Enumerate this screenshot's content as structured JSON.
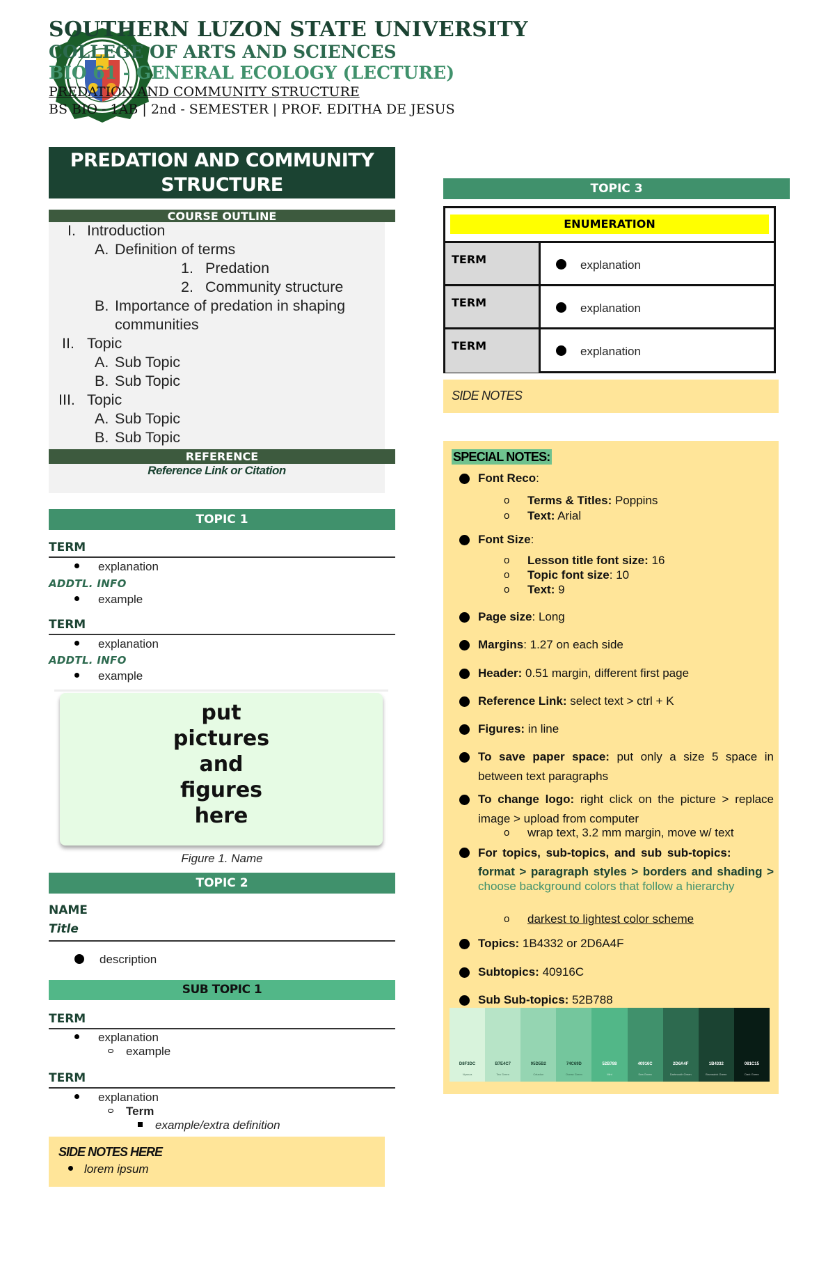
{
  "header": {
    "university": "SOUTHERN LUZON STATE UNIVERSITY",
    "college": "COLLEGE OF ARTS AND SCIENCES",
    "course": "BIO 61 - GENERAL ECOLOGY  (LECTURE)",
    "lesson": "PREDATION AND COMMUNITY STRUCTURE",
    "meta": "BS BIO - 1AB | 2nd - SEMESTER | PROF. EDITHA DE JESUS",
    "logo": "university-seal"
  },
  "lesson_title": "PREDATION AND COMMUNITY STRUCTURE",
  "outline": {
    "label": "COURSE OUTLINE",
    "items": [
      {
        "num": "I.",
        "text": "Introduction"
      },
      {
        "num": "A.",
        "text": "Definition of terms"
      },
      {
        "num": "1.",
        "text": "Predation"
      },
      {
        "num": "2.",
        "text": "Community structure"
      },
      {
        "num": "B.",
        "text": "Importance of predation in shaping"
      },
      {
        "num": "",
        "text": "communities"
      },
      {
        "num": "II.",
        "text": "Topic"
      },
      {
        "num": "A.",
        "text": "Sub Topic"
      },
      {
        "num": "B.",
        "text": "Sub Topic"
      },
      {
        "num": "III.",
        "text": "Topic"
      },
      {
        "num": "A.",
        "text": "Sub Topic"
      },
      {
        "num": "B.",
        "text": "Sub Topic"
      }
    ]
  },
  "reference": {
    "label": "REFERENCE",
    "text": "Reference Link or Citation"
  },
  "topic1": {
    "label": "TOPIC 1",
    "blocks": [
      {
        "term": "TERM",
        "explanation": "explanation",
        "addtl_label": "ADDTL. INFO",
        "example": "example"
      },
      {
        "term": "TERM",
        "explanation": "explanation",
        "addtl_label": "ADDTL. INFO",
        "example": "example"
      }
    ],
    "figure_placeholder": [
      "put",
      "pictures",
      "and",
      "figures",
      "here"
    ],
    "figure_caption": "Figure 1. Name"
  },
  "topic2": {
    "label": "TOPIC 2",
    "name": "NAME",
    "title": "Title",
    "description": "description",
    "subtopic": {
      "label": "SUB TOPIC 1",
      "blocks": [
        {
          "term": "TERM",
          "explanation": "explanation",
          "example": "example"
        },
        {
          "term": "TERM",
          "explanation": "explanation",
          "subterm": "Term",
          "extra": "example/extra definition"
        }
      ]
    },
    "side_notes": {
      "heading": "SIDE NOTES HERE",
      "item": "lorem ipsum"
    }
  },
  "topic3": {
    "label": "TOPIC 3",
    "enumeration_label": "ENUMERATION",
    "rows": [
      {
        "term": "TERM",
        "explanation": "explanation"
      },
      {
        "term": "TERM",
        "explanation": "explanation"
      },
      {
        "term": "TERM",
        "explanation": "explanation"
      }
    ],
    "side_notes": "SIDE NOTES"
  },
  "special_notes": {
    "heading": "SPECIAL NOTES:",
    "font_reco": {
      "label": "Font Reco",
      "items": [
        {
          "label": "Terms & Titles:",
          "value": " Poppins"
        },
        {
          "label": "Text:",
          "value": " Arial"
        }
      ]
    },
    "font_size": {
      "label": "Font Size",
      "items": [
        {
          "label": "Lesson title font size:",
          "value": " 16"
        },
        {
          "label": "Topic font size",
          "value": ": 10"
        },
        {
          "label": "Text:",
          "value": " 9"
        }
      ]
    },
    "page_size": {
      "label": "Page size",
      "value": ": Long"
    },
    "margins": {
      "label": "Margins",
      "value": ": 1.27 on each side"
    },
    "header": {
      "label": "Header:",
      "value": " 0.51 margin, different first  page"
    },
    "reference_link": {
      "label": "Reference Link:",
      "value": " select text > ctrl + K"
    },
    "figures": {
      "label": "Figures:",
      "value": " in line"
    },
    "save_space": {
      "label": "To save paper space:",
      "value": "  put only a size 5 space in between text paragraphs"
    },
    "change_logo": {
      "label": "To change logo:",
      "value": " right click on the picture > replace image > upload from computer",
      "sub": "wrap text, 3.2 mm margin, move w/ text"
    },
    "hierarchy": {
      "label": "For topics, sub-topics, and sub sub-topics:",
      "path": "format > paragraph styles > borders and shading >",
      "hint": " choose background colors that follow a hierarchy",
      "sub": "darkest to lightest color scheme"
    },
    "topics": {
      "label": "Topics:",
      "value": " 1B4332 or 2D6A4F"
    },
    "subtopics": {
      "label": "Subtopics:",
      "value": " 40916C"
    },
    "subsubtopics": {
      "label": "Sub Sub-topics:",
      "value": " 52B788"
    }
  },
  "palette": [
    {
      "hex": "D8F3DC",
      "color": "#d8f3dc",
      "name": "Nyanza"
    },
    {
      "hex": "B7E4C7",
      "color": "#b7e4c7",
      "name": "Tea Green"
    },
    {
      "hex": "95D5B2",
      "color": "#95d5b2",
      "name": "Celadon"
    },
    {
      "hex": "74C69D",
      "color": "#74c69d",
      "name": "Ocean Green"
    },
    {
      "hex": "52B788",
      "color": "#52b788",
      "name": "Mint"
    },
    {
      "hex": "40916C",
      "color": "#40916c",
      "name": "Sea Green"
    },
    {
      "hex": "2D6A4F",
      "color": "#2d6a4f",
      "name": "Dartmouth Green"
    },
    {
      "hex": "1B4332",
      "color": "#1b4332",
      "name": "Brunswick Green"
    },
    {
      "hex": "081C15",
      "color": "#081c15",
      "name": "Dark Green"
    }
  ],
  "colors": {
    "topic": "#1B4332",
    "topic_alt": "#2D6A4F",
    "subtopic": "#40916C",
    "subsubtopic": "#52B788",
    "notes_bg": "#FFE599",
    "enum_highlight": "#FFFF00"
  }
}
